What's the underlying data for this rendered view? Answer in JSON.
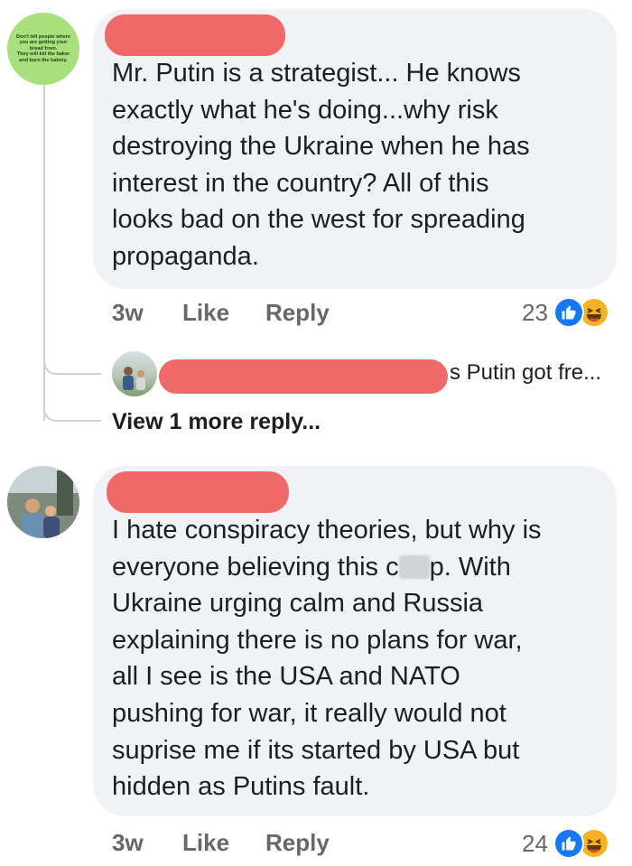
{
  "comments": [
    {
      "avatar_text": [
        "Don't tell people where",
        "you are getting your",
        "bread from.",
        "They will kill the baker",
        "and burn the bakery."
      ],
      "body": "Mr. Putin is a strategist... He knows\nexactly what he's doing...why risk\ndestroying the Ukraine when he has\ninterest in the country? All of this\nlooks bad on the west for spreading\npropaganda.",
      "time": "3w",
      "like_label": "Like",
      "reply_label": "Reply",
      "reaction_count": "23"
    },
    {
      "body_part1": "I hate conspiracy theories, but why is\neveryone believing this c",
      "body_part2": "p. With\nUkraine urging calm and Russia\nexplaining there is no plans for war,\nall I see is the USA and NATO\npushing for war, it really would not\nsuprise me if its started by USA but\nhidden as Putins fault.",
      "time": "3w",
      "like_label": "Like",
      "reply_label": "Reply",
      "reaction_count": "24"
    }
  ],
  "reply_preview": {
    "text": "s Putin got fre..."
  },
  "view_more_label": "View 1 more reply...",
  "colors": {
    "bubble": "#f0f2f5",
    "redaction": "#ee6a6a",
    "like_blue": "#1877f2",
    "haha_yellow": "#f7b125",
    "muted_text": "#65676b"
  },
  "icons": {
    "like": "thumbs-up-icon",
    "haha": "laughing-face-icon"
  }
}
